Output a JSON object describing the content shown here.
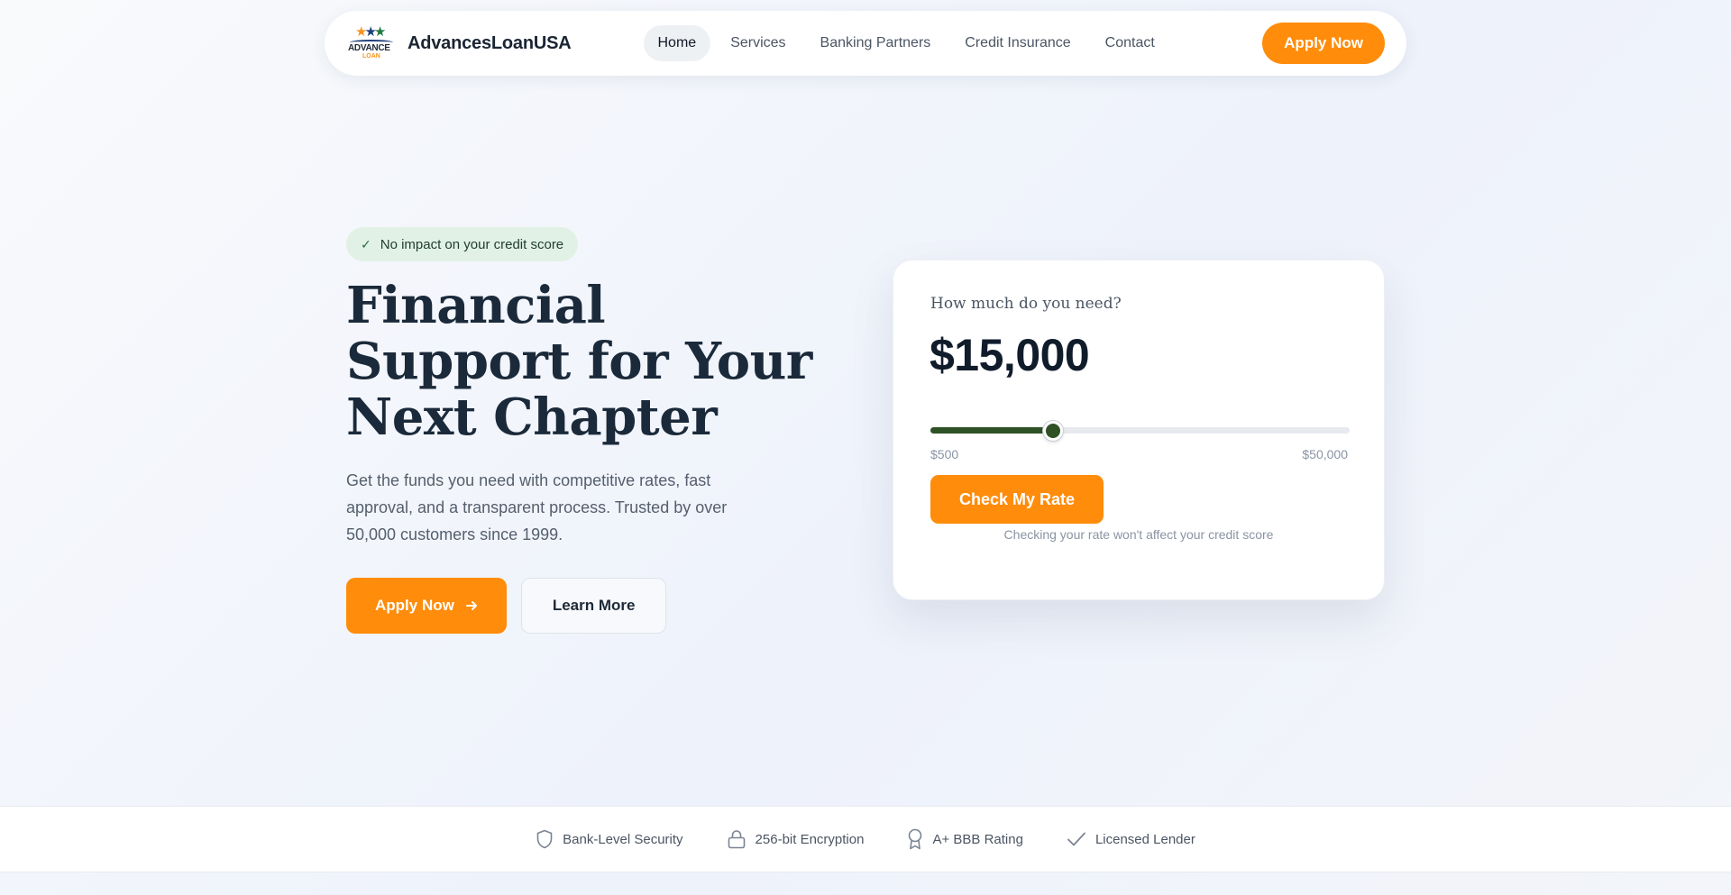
{
  "nav": {
    "brand": "AdvancesLoanUSA",
    "logo_text_top": "ADVANCE",
    "logo_text_bottom": "LOAN",
    "items": [
      {
        "label": "Home",
        "active": true
      },
      {
        "label": "Services",
        "active": false
      },
      {
        "label": "Banking Partners",
        "active": false
      },
      {
        "label": "Credit Insurance",
        "active": false
      },
      {
        "label": "Contact",
        "active": false
      }
    ],
    "apply_label": "Apply Now"
  },
  "hero": {
    "badge": "No impact on your credit score",
    "headline": "Financial Support for Your Next Chapter",
    "subtext": "Get the funds you need with competitive rates, fast approval, and a transparent process. Trusted by over 50,000 customers since 1999.",
    "primary_cta": "Apply Now",
    "secondary_cta": "Learn More"
  },
  "calculator": {
    "question": "How much do you need?",
    "amount": "$15,000",
    "min_label": "$500",
    "max_label": "$50,000",
    "slider": {
      "min": 500,
      "max": 50000,
      "value": 15000
    },
    "button": "Check My Rate",
    "note": "Checking your rate won't affect your credit score"
  },
  "trust": [
    {
      "icon": "shield-icon",
      "label": "Bank-Level Security"
    },
    {
      "icon": "lock-icon",
      "label": "256-bit Encryption"
    },
    {
      "icon": "award-icon",
      "label": "A+ BBB Rating"
    },
    {
      "icon": "check-icon",
      "label": "Licensed Lender"
    }
  ],
  "colors": {
    "accent": "#ff8c0a",
    "slider": "#2f5126",
    "badge_bg": "#e2f1e6",
    "heading": "#1b2a3a"
  }
}
